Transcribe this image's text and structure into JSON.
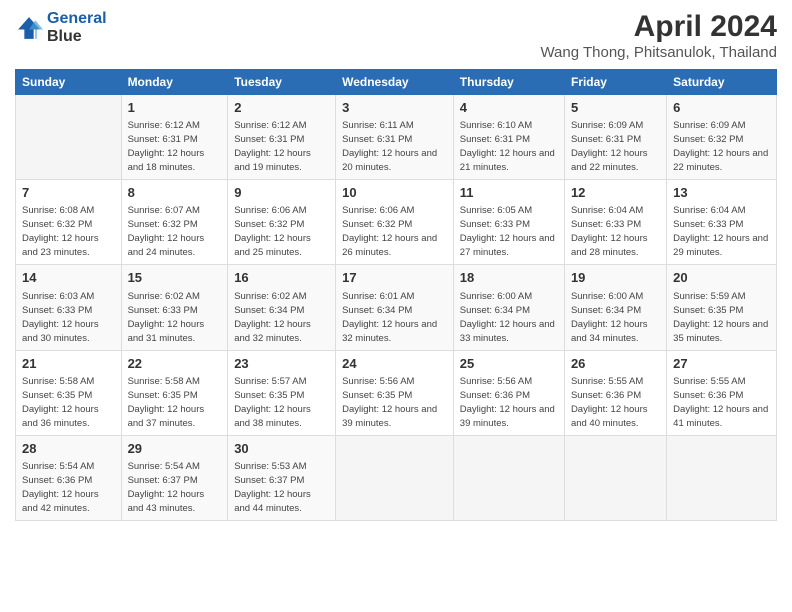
{
  "header": {
    "logo_line1": "General",
    "logo_line2": "Blue",
    "title": "April 2024",
    "subtitle": "Wang Thong, Phitsanulok, Thailand"
  },
  "weekdays": [
    "Sunday",
    "Monday",
    "Tuesday",
    "Wednesday",
    "Thursday",
    "Friday",
    "Saturday"
  ],
  "weeks": [
    [
      {
        "day": "",
        "empty": true
      },
      {
        "day": "1",
        "sunrise": "6:12 AM",
        "sunset": "6:31 PM",
        "daylight": "12 hours and 18 minutes."
      },
      {
        "day": "2",
        "sunrise": "6:12 AM",
        "sunset": "6:31 PM",
        "daylight": "12 hours and 19 minutes."
      },
      {
        "day": "3",
        "sunrise": "6:11 AM",
        "sunset": "6:31 PM",
        "daylight": "12 hours and 20 minutes."
      },
      {
        "day": "4",
        "sunrise": "6:10 AM",
        "sunset": "6:31 PM",
        "daylight": "12 hours and 21 minutes."
      },
      {
        "day": "5",
        "sunrise": "6:09 AM",
        "sunset": "6:31 PM",
        "daylight": "12 hours and 22 minutes."
      },
      {
        "day": "6",
        "sunrise": "6:09 AM",
        "sunset": "6:32 PM",
        "daylight": "12 hours and 22 minutes."
      }
    ],
    [
      {
        "day": "7",
        "sunrise": "6:08 AM",
        "sunset": "6:32 PM",
        "daylight": "12 hours and 23 minutes."
      },
      {
        "day": "8",
        "sunrise": "6:07 AM",
        "sunset": "6:32 PM",
        "daylight": "12 hours and 24 minutes."
      },
      {
        "day": "9",
        "sunrise": "6:06 AM",
        "sunset": "6:32 PM",
        "daylight": "12 hours and 25 minutes."
      },
      {
        "day": "10",
        "sunrise": "6:06 AM",
        "sunset": "6:32 PM",
        "daylight": "12 hours and 26 minutes."
      },
      {
        "day": "11",
        "sunrise": "6:05 AM",
        "sunset": "6:33 PM",
        "daylight": "12 hours and 27 minutes."
      },
      {
        "day": "12",
        "sunrise": "6:04 AM",
        "sunset": "6:33 PM",
        "daylight": "12 hours and 28 minutes."
      },
      {
        "day": "13",
        "sunrise": "6:04 AM",
        "sunset": "6:33 PM",
        "daylight": "12 hours and 29 minutes."
      }
    ],
    [
      {
        "day": "14",
        "sunrise": "6:03 AM",
        "sunset": "6:33 PM",
        "daylight": "12 hours and 30 minutes."
      },
      {
        "day": "15",
        "sunrise": "6:02 AM",
        "sunset": "6:33 PM",
        "daylight": "12 hours and 31 minutes."
      },
      {
        "day": "16",
        "sunrise": "6:02 AM",
        "sunset": "6:34 PM",
        "daylight": "12 hours and 32 minutes."
      },
      {
        "day": "17",
        "sunrise": "6:01 AM",
        "sunset": "6:34 PM",
        "daylight": "12 hours and 32 minutes."
      },
      {
        "day": "18",
        "sunrise": "6:00 AM",
        "sunset": "6:34 PM",
        "daylight": "12 hours and 33 minutes."
      },
      {
        "day": "19",
        "sunrise": "6:00 AM",
        "sunset": "6:34 PM",
        "daylight": "12 hours and 34 minutes."
      },
      {
        "day": "20",
        "sunrise": "5:59 AM",
        "sunset": "6:35 PM",
        "daylight": "12 hours and 35 minutes."
      }
    ],
    [
      {
        "day": "21",
        "sunrise": "5:58 AM",
        "sunset": "6:35 PM",
        "daylight": "12 hours and 36 minutes."
      },
      {
        "day": "22",
        "sunrise": "5:58 AM",
        "sunset": "6:35 PM",
        "daylight": "12 hours and 37 minutes."
      },
      {
        "day": "23",
        "sunrise": "5:57 AM",
        "sunset": "6:35 PM",
        "daylight": "12 hours and 38 minutes."
      },
      {
        "day": "24",
        "sunrise": "5:56 AM",
        "sunset": "6:35 PM",
        "daylight": "12 hours and 39 minutes."
      },
      {
        "day": "25",
        "sunrise": "5:56 AM",
        "sunset": "6:36 PM",
        "daylight": "12 hours and 39 minutes."
      },
      {
        "day": "26",
        "sunrise": "5:55 AM",
        "sunset": "6:36 PM",
        "daylight": "12 hours and 40 minutes."
      },
      {
        "day": "27",
        "sunrise": "5:55 AM",
        "sunset": "6:36 PM",
        "daylight": "12 hours and 41 minutes."
      }
    ],
    [
      {
        "day": "28",
        "sunrise": "5:54 AM",
        "sunset": "6:36 PM",
        "daylight": "12 hours and 42 minutes."
      },
      {
        "day": "29",
        "sunrise": "5:54 AM",
        "sunset": "6:37 PM",
        "daylight": "12 hours and 43 minutes."
      },
      {
        "day": "30",
        "sunrise": "5:53 AM",
        "sunset": "6:37 PM",
        "daylight": "12 hours and 44 minutes."
      },
      {
        "day": "",
        "empty": true
      },
      {
        "day": "",
        "empty": true
      },
      {
        "day": "",
        "empty": true
      },
      {
        "day": "",
        "empty": true
      }
    ]
  ]
}
